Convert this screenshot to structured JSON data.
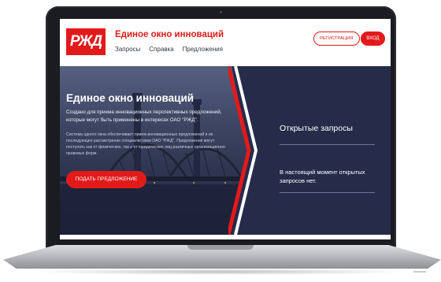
{
  "site": {
    "logo_text": "РЖД",
    "title": "Единое окно инноваций",
    "nav": [
      "Запросы",
      "Справка",
      "Предложения"
    ],
    "register_label": "РЕГИСТРАЦИЯ",
    "login_label": "ВХОД"
  },
  "hero": {
    "title": "Единое окно инноваций",
    "lead": "Создано для приема инновационных перспективных предложений, которые могут быть применены в интересах ОАО \"РЖД\".",
    "text": "Система одного окна обеспечивает прием инновационных предложений и их последующее рассмотрение специалистами ОАО \"РЖД\". Предложения могут поступать как от физических, так и от юридических лиц различных организационно-правовых форм.",
    "button_label": "ПОДАТЬ ПРЕДЛОЖЕНИЕ"
  },
  "open_requests": {
    "title": "Открытые запросы",
    "text": "В настоящий момент открытых запросов нет."
  },
  "colors": {
    "brand_red": "#e21a1a",
    "hero_navy": "#262b4a"
  }
}
